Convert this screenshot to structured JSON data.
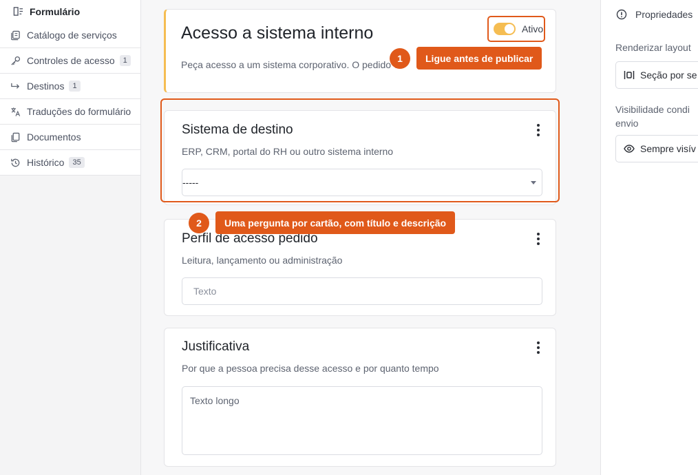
{
  "sidebar": {
    "items": [
      {
        "label": "Formulário",
        "icon": "form-icon"
      },
      {
        "label": "Catálogo de serviços",
        "icon": "catalog-icon"
      },
      {
        "label": "Controles de acesso",
        "icon": "key-icon",
        "count": "1"
      },
      {
        "label": "Destinos",
        "icon": "arrow-route-icon",
        "count": "1"
      },
      {
        "label": "Traduções do formulário",
        "icon": "translate-icon"
      },
      {
        "label": "Documentos",
        "icon": "documents-icon"
      },
      {
        "label": "Histórico",
        "icon": "history-icon",
        "count": "35"
      }
    ]
  },
  "form": {
    "title": "Acesso a sistema interno",
    "description": "Peça acesso a um sistema corporativo. O pedido va",
    "toggle_label": "Ativo",
    "toggle_on": true
  },
  "questions": [
    {
      "title": "Sistema de destino",
      "description": "ERP, CRM, portal do RH ou outro sistema interno",
      "value": "-----"
    },
    {
      "title": "Perfil de acesso pedido",
      "description": "Leitura, lançamento ou administração",
      "placeholder": "Texto"
    },
    {
      "title": "Justificativa",
      "description": "Por que a pessoa precisa desse acesso e por quanto tempo",
      "placeholder": "Texto longo"
    }
  ],
  "callouts": [
    {
      "number": "1",
      "text": "Ligue antes de publicar"
    },
    {
      "number": "2",
      "text": "Uma pergunta por cartão, com título e descrição"
    }
  ],
  "right_panel": {
    "header": "Propriedades",
    "render_label": "Renderizar layout",
    "render_value": "Seção por se",
    "visibility_label_line1": "Visibilidade condi",
    "visibility_label_line2": "envio",
    "visibility_value": "Sempre visív"
  },
  "colors": {
    "accent": "#e0591a",
    "toggle": "#f5bd52",
    "title_bar": "#f5bd52"
  }
}
